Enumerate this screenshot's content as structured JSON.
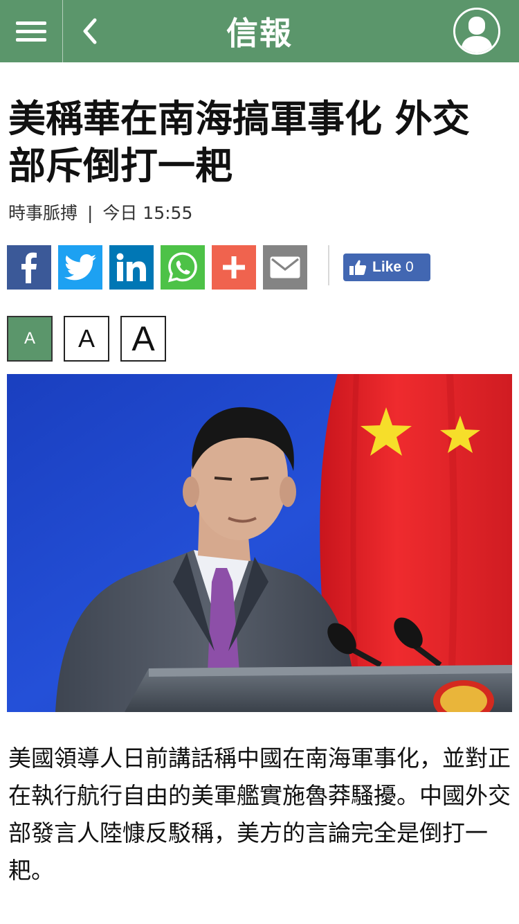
{
  "header": {
    "menu_icon": "hamburger-menu-icon",
    "back_icon": "chevron-left-icon",
    "logo_text": "信報",
    "user_icon": "user-avatar-icon"
  },
  "article": {
    "title": "美稱華在南海搞軍事化 外交部斥倒打一耙",
    "section": "時事脈搏",
    "separator": "|",
    "time": "今日 15:55",
    "body": "美國領導人日前講話稱中國在南海軍事化，並對正在執行航行自由的美軍艦實施魯莽騷擾。中國外交部發言人陸慷反駁稱，美方的言論完全是倒打一耙。"
  },
  "share": {
    "buttons": [
      {
        "name": "facebook",
        "icon": "facebook-icon",
        "color": "#3b5998"
      },
      {
        "name": "twitter",
        "icon": "twitter-icon",
        "color": "#1da1f2"
      },
      {
        "name": "linkedin",
        "icon": "linkedin-icon",
        "color": "#0077b5"
      },
      {
        "name": "whatsapp",
        "icon": "whatsapp-icon",
        "color": "#4dc247"
      },
      {
        "name": "more",
        "icon": "plus-icon",
        "color": "#f0634e"
      },
      {
        "name": "email",
        "icon": "email-icon",
        "color": "#848484"
      }
    ],
    "fb_like": {
      "label": "Like",
      "count": "0",
      "icon": "thumbs-up-icon",
      "color": "#4267b2"
    }
  },
  "font_size": {
    "options": [
      {
        "label": "A",
        "active": true
      },
      {
        "label": "A",
        "active": false
      },
      {
        "label": "A",
        "active": false
      }
    ]
  },
  "colors": {
    "brand_green": "#5b966b",
    "photo_background_blue": "#1b48c9",
    "flag_red": "#e8232a",
    "flag_star_yellow": "#f6de2a"
  }
}
